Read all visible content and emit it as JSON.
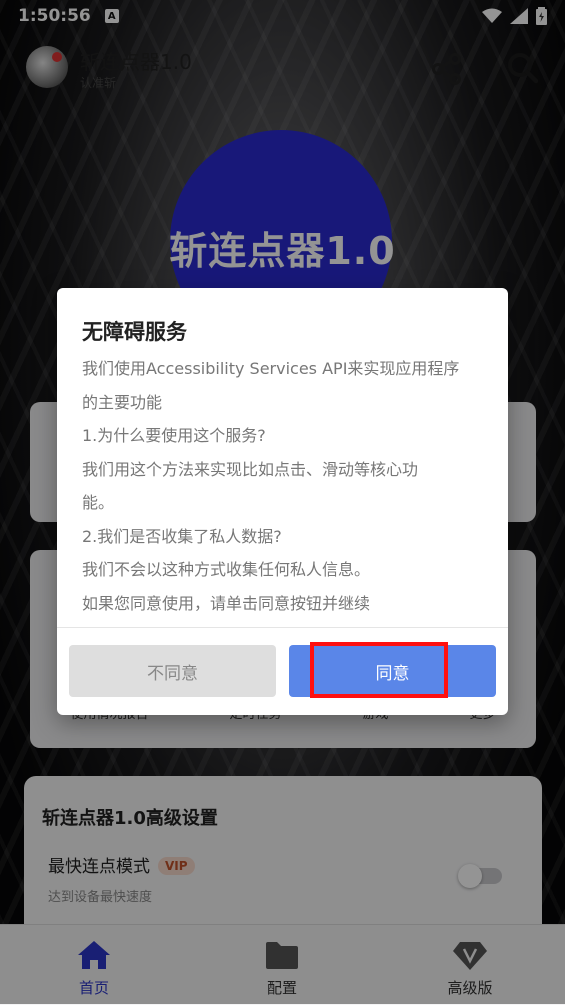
{
  "status_bar": {
    "time": "1:50:56",
    "notification_badge": "A"
  },
  "app_bar": {
    "title": "斩连点器1.0",
    "subtitle": "认准斩",
    "share_icon": "share-icon",
    "search_icon": "search-icon"
  },
  "hero": {
    "title": "斩连点器1.0",
    "circle_color": "#2a2ad0"
  },
  "feature_card": {
    "labels": [
      "使用情况报告",
      "定时任务",
      "游戏",
      "更多"
    ]
  },
  "advanced_settings": {
    "title": "斩连点器1.0高级设置",
    "fastest_mode_title": "最快连点模式",
    "vip_badge": "VIP",
    "fastest_mode_sub": "达到设备最快速度",
    "toggle_on": false
  },
  "bottom_nav": {
    "items": [
      "首页",
      "配置",
      "高级版"
    ],
    "active_index": 0
  },
  "dialog": {
    "title": "无障碍服务",
    "lines": [
      "我们使用Accessibility Services API来实现应用程序",
      "的主要功能",
      "1.为什么要使用这个服务?",
      "我们用这个方法来实现比如点击、滑动等核心功",
      "能。",
      "2.我们是否收集了私人数据?",
      "我们不会以这种方式收集任何私人信息。",
      "如果您同意使用，请单击同意按钮并继续"
    ],
    "disagree_label": "不同意",
    "agree_label": "同意",
    "agree_color": "#5a86e8",
    "highlight_color": "#ff1010"
  }
}
